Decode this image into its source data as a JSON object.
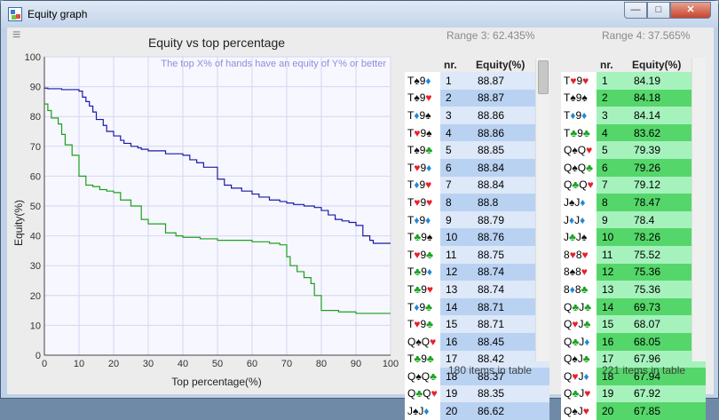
{
  "window": {
    "title": "Equity graph",
    "minimize_icon": "minimize-icon",
    "maximize_icon": "maximize-icon",
    "close_icon": "close-icon"
  },
  "menu_icon": "hamburger-icon",
  "chart_data": {
    "type": "line",
    "title": "Equity vs top percentage",
    "annotation": "The top X% of hands have an equity of Y% or better",
    "xlabel": "Top percentage(%)",
    "ylabel": "Equity(%)",
    "xlim": [
      0,
      100
    ],
    "ylim": [
      0,
      100
    ],
    "xticks": [
      0,
      10,
      20,
      30,
      40,
      50,
      60,
      70,
      80,
      90,
      100
    ],
    "yticks": [
      0,
      10,
      20,
      30,
      40,
      50,
      60,
      70,
      80,
      90,
      100
    ],
    "grid": true,
    "series": [
      {
        "color": "#1a1aa8",
        "x": [
          0,
          1,
          5,
          10,
          11,
          12,
          13,
          14,
          15,
          17,
          18,
          20,
          22,
          23,
          25,
          27,
          28,
          30,
          35,
          40,
          42,
          44,
          46,
          50,
          52,
          54,
          57,
          60,
          62,
          65,
          68,
          70,
          72,
          75,
          78,
          80,
          82,
          84,
          86,
          88,
          90,
          92,
          94,
          95,
          97,
          100
        ],
        "y": [
          89.5,
          89.3,
          89,
          88.5,
          86.5,
          85,
          83.5,
          81.5,
          79,
          77,
          75,
          73.5,
          72,
          71,
          70,
          69.5,
          69,
          68.5,
          67.5,
          67,
          65.5,
          64.5,
          63,
          59,
          57,
          56,
          55,
          54,
          53,
          52,
          51.5,
          51,
          50.5,
          50,
          49.5,
          48.5,
          47,
          45.5,
          45,
          44.5,
          43.5,
          40,
          38.5,
          37.5,
          37.5,
          37.5
        ]
      },
      {
        "color": "#1ca01c",
        "x": [
          0,
          1,
          2,
          4,
          5,
          6,
          8,
          10,
          12,
          14,
          16,
          18,
          20,
          22,
          25,
          28,
          30,
          35,
          38,
          40,
          45,
          50,
          55,
          60,
          65,
          68,
          70,
          71,
          73,
          75,
          77,
          78,
          80,
          85,
          90,
          92,
          95,
          100
        ],
        "y": [
          84.2,
          82,
          79.5,
          77.5,
          74,
          70.5,
          67,
          60,
          57,
          56.5,
          55.5,
          55,
          54.5,
          52,
          50,
          45.5,
          44,
          41,
          40,
          39.5,
          39,
          38.5,
          38.5,
          38,
          37.5,
          37,
          33,
          30,
          28,
          26,
          24,
          20,
          15,
          14.5,
          14,
          14,
          14,
          14
        ]
      }
    ]
  },
  "range3": {
    "title": "Range 3: 62.435%",
    "col_nr": "nr.",
    "col_eq": "Equity(%)",
    "footer": "180 items in table",
    "rows": [
      {
        "c1": "T",
        "s1": "♠",
        "k1": "blk",
        "c2": "9",
        "s2": "♦",
        "k2": "blu",
        "nr": "1",
        "eq": "88.87"
      },
      {
        "c1": "T",
        "s1": "♠",
        "k1": "blk",
        "c2": "9",
        "s2": "♥",
        "k2": "red",
        "nr": "2",
        "eq": "88.87"
      },
      {
        "c1": "T",
        "s1": "♦",
        "k1": "blu",
        "c2": "9",
        "s2": "♠",
        "k2": "blk",
        "nr": "3",
        "eq": "88.86"
      },
      {
        "c1": "T",
        "s1": "♥",
        "k1": "red",
        "c2": "9",
        "s2": "♠",
        "k2": "blk",
        "nr": "4",
        "eq": "88.86"
      },
      {
        "c1": "T",
        "s1": "♠",
        "k1": "blk",
        "c2": "9",
        "s2": "♣",
        "k2": "grn",
        "nr": "5",
        "eq": "88.85"
      },
      {
        "c1": "T",
        "s1": "♥",
        "k1": "red",
        "c2": "9",
        "s2": "♦",
        "k2": "blu",
        "nr": "6",
        "eq": "88.84"
      },
      {
        "c1": "T",
        "s1": "♦",
        "k1": "blu",
        "c2": "9",
        "s2": "♥",
        "k2": "red",
        "nr": "7",
        "eq": "88.84"
      },
      {
        "c1": "T",
        "s1": "♥",
        "k1": "red",
        "c2": "9",
        "s2": "♥",
        "k2": "red",
        "nr": "8",
        "eq": "88.8"
      },
      {
        "c1": "T",
        "s1": "♦",
        "k1": "blu",
        "c2": "9",
        "s2": "♦",
        "k2": "blu",
        "nr": "9",
        "eq": "88.79"
      },
      {
        "c1": "T",
        "s1": "♣",
        "k1": "grn",
        "c2": "9",
        "s2": "♠",
        "k2": "blk",
        "nr": "10",
        "eq": "88.76"
      },
      {
        "c1": "T",
        "s1": "♥",
        "k1": "red",
        "c2": "9",
        "s2": "♣",
        "k2": "grn",
        "nr": "11",
        "eq": "88.75"
      },
      {
        "c1": "T",
        "s1": "♣",
        "k1": "grn",
        "c2": "9",
        "s2": "♦",
        "k2": "blu",
        "nr": "12",
        "eq": "88.74"
      },
      {
        "c1": "T",
        "s1": "♣",
        "k1": "grn",
        "c2": "9",
        "s2": "♥",
        "k2": "red",
        "nr": "13",
        "eq": "88.74"
      },
      {
        "c1": "T",
        "s1": "♦",
        "k1": "blu",
        "c2": "9",
        "s2": "♣",
        "k2": "grn",
        "nr": "14",
        "eq": "88.71"
      },
      {
        "c1": "T",
        "s1": "♥",
        "k1": "red",
        "c2": "9",
        "s2": "♣",
        "k2": "grn",
        "nr": "15",
        "eq": "88.71"
      },
      {
        "c1": "Q",
        "s1": "♠",
        "k1": "blk",
        "c2": "Q",
        "s2": "♥",
        "k2": "red",
        "nr": "16",
        "eq": "88.45"
      },
      {
        "c1": "T",
        "s1": "♣",
        "k1": "grn",
        "c2": "9",
        "s2": "♣",
        "k2": "grn",
        "nr": "17",
        "eq": "88.42"
      },
      {
        "c1": "Q",
        "s1": "♠",
        "k1": "blk",
        "c2": "Q",
        "s2": "♣",
        "k2": "grn",
        "nr": "18",
        "eq": "88.37"
      },
      {
        "c1": "Q",
        "s1": "♣",
        "k1": "grn",
        "c2": "Q",
        "s2": "♥",
        "k2": "red",
        "nr": "19",
        "eq": "88.35"
      },
      {
        "c1": "J",
        "s1": "♠",
        "k1": "blk",
        "c2": "J",
        "s2": "♦",
        "k2": "blu",
        "nr": "20",
        "eq": "86.62"
      }
    ]
  },
  "range4": {
    "title": "Range 4: 37.565%",
    "col_nr": "nr.",
    "col_eq": "Equity(%)",
    "footer": "221 items in table",
    "rows": [
      {
        "c1": "T",
        "s1": "♥",
        "k1": "red",
        "c2": "9",
        "s2": "♥",
        "k2": "red",
        "nr": "1",
        "eq": "84.19"
      },
      {
        "c1": "T",
        "s1": "♠",
        "k1": "blk",
        "c2": "9",
        "s2": "♠",
        "k2": "blk",
        "nr": "2",
        "eq": "84.18"
      },
      {
        "c1": "T",
        "s1": "♦",
        "k1": "blu",
        "c2": "9",
        "s2": "♦",
        "k2": "blu",
        "nr": "3",
        "eq": "84.14"
      },
      {
        "c1": "T",
        "s1": "♣",
        "k1": "grn",
        "c2": "9",
        "s2": "♣",
        "k2": "grn",
        "nr": "4",
        "eq": "83.62"
      },
      {
        "c1": "Q",
        "s1": "♠",
        "k1": "blk",
        "c2": "Q",
        "s2": "♥",
        "k2": "red",
        "nr": "5",
        "eq": "79.39"
      },
      {
        "c1": "Q",
        "s1": "♠",
        "k1": "blk",
        "c2": "Q",
        "s2": "♣",
        "k2": "grn",
        "nr": "6",
        "eq": "79.26"
      },
      {
        "c1": "Q",
        "s1": "♣",
        "k1": "grn",
        "c2": "Q",
        "s2": "♥",
        "k2": "red",
        "nr": "7",
        "eq": "79.12"
      },
      {
        "c1": "J",
        "s1": "♠",
        "k1": "blk",
        "c2": "J",
        "s2": "♦",
        "k2": "blu",
        "nr": "8",
        "eq": "78.47"
      },
      {
        "c1": "J",
        "s1": "♦",
        "k1": "blu",
        "c2": "J",
        "s2": "♦",
        "k2": "blu",
        "nr": "9",
        "eq": "78.4"
      },
      {
        "c1": "J",
        "s1": "♣",
        "k1": "grn",
        "c2": "J",
        "s2": "♠",
        "k2": "blk",
        "nr": "10",
        "eq": "78.26"
      },
      {
        "c1": "8",
        "s1": "♥",
        "k1": "red",
        "c2": "8",
        "s2": "♥",
        "k2": "red",
        "nr": "11",
        "eq": "75.52"
      },
      {
        "c1": "8",
        "s1": "♠",
        "k1": "blk",
        "c2": "8",
        "s2": "♥",
        "k2": "red",
        "nr": "12",
        "eq": "75.36"
      },
      {
        "c1": "8",
        "s1": "♦",
        "k1": "blu",
        "c2": "8",
        "s2": "♣",
        "k2": "grn",
        "nr": "13",
        "eq": "75.36"
      },
      {
        "c1": "Q",
        "s1": "♣",
        "k1": "grn",
        "c2": "J",
        "s2": "♣",
        "k2": "grn",
        "nr": "14",
        "eq": "69.73"
      },
      {
        "c1": "Q",
        "s1": "♥",
        "k1": "red",
        "c2": "J",
        "s2": "♣",
        "k2": "grn",
        "nr": "15",
        "eq": "68.07"
      },
      {
        "c1": "Q",
        "s1": "♣",
        "k1": "grn",
        "c2": "J",
        "s2": "♦",
        "k2": "blu",
        "nr": "16",
        "eq": "68.05"
      },
      {
        "c1": "Q",
        "s1": "♠",
        "k1": "blk",
        "c2": "J",
        "s2": "♣",
        "k2": "grn",
        "nr": "17",
        "eq": "67.96"
      },
      {
        "c1": "Q",
        "s1": "♥",
        "k1": "red",
        "c2": "J",
        "s2": "♦",
        "k2": "blu",
        "nr": "18",
        "eq": "67.94"
      },
      {
        "c1": "Q",
        "s1": "♣",
        "k1": "grn",
        "c2": "J",
        "s2": "♥",
        "k2": "red",
        "nr": "19",
        "eq": "67.92"
      },
      {
        "c1": "Q",
        "s1": "♠",
        "k1": "blk",
        "c2": "J",
        "s2": "♥",
        "k2": "red",
        "nr": "20",
        "eq": "67.85"
      }
    ]
  }
}
